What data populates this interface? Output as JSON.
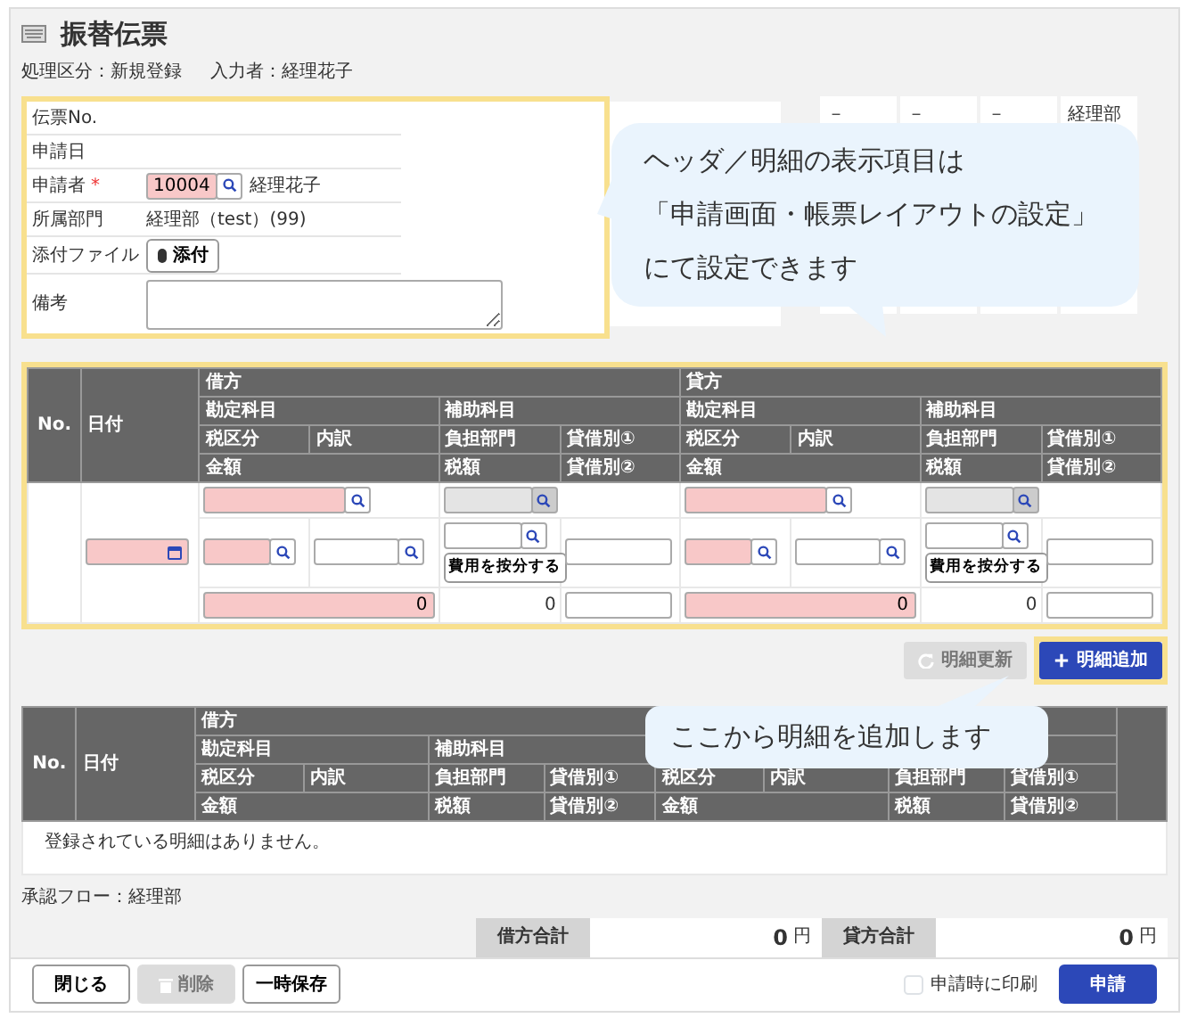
{
  "title": "振替伝票",
  "meta": [
    "処理区分：新規登録",
    "入力者：経理花子"
  ],
  "header_section": {
    "highlighted": true,
    "rows": [
      {
        "kind": "text",
        "label": "伝票No."
      },
      {
        "kind": "text",
        "label": "申請日"
      },
      {
        "kind": "lookup",
        "label": "申請者",
        "required_mark": "*",
        "value": "10004",
        "name_text": "経理花子"
      },
      {
        "kind": "text",
        "label": "所属部門",
        "value": "経理部（test）(99)"
      },
      {
        "kind": "attach",
        "label": "添付ファイル",
        "button": "添付"
      },
      {
        "kind": "textarea",
        "label": "備考"
      }
    ],
    "side_cells": [
      "－",
      "－",
      "－",
      "経理部"
    ],
    "callout": {
      "lines": [
        "ヘッダ／明細の表示項目は",
        "「申請画面・帳票レイアウトの設定」",
        "にて設定できます"
      ]
    }
  },
  "entry_table": {
    "highlighted": true,
    "header": {
      "no": "No.",
      "date": "日付",
      "sides": [
        {
          "title": "借方",
          "account": "勘定科目",
          "sub_account": "補助科目",
          "tax_class": "税区分",
          "detail": "内訳",
          "dept": "負担部門",
          "flag1": "貸借別①",
          "amount": "金額",
          "tax": "税額",
          "flag2": "貸借別②"
        },
        {
          "title": "貸方",
          "account": "勘定科目",
          "sub_account": "補助科目",
          "tax_class": "税区分",
          "detail": "内訳",
          "dept": "負担部門",
          "flag1": "貸借別①",
          "amount": "金額",
          "tax": "税額",
          "flag2": "貸借別②"
        }
      ]
    },
    "sides": [
      {
        "amount": "0",
        "tax": "0",
        "allocate_button": "費用を按分する"
      },
      {
        "amount": "0",
        "tax": "0",
        "allocate_button": "費用を按分する"
      }
    ]
  },
  "detail_buttons": {
    "buttons": [
      {
        "label": "明細更新",
        "kind": "update",
        "disabled": true,
        "highlighted": false
      },
      {
        "label": "明細追加",
        "kind": "add",
        "disabled": false,
        "highlighted": true
      }
    ],
    "callout": {
      "lines": [
        "ここから明細を追加します"
      ]
    }
  },
  "list_table": {
    "header": {
      "no": "No.",
      "date": "日付",
      "sides": [
        {
          "title": "借方",
          "account": "勘定科目",
          "sub_account": "補助科目",
          "tax_class": "税区分",
          "detail": "内訳",
          "dept": "負担部門",
          "flag1": "貸借別①",
          "amount": "金額",
          "tax": "税額",
          "flag2": "貸借別②"
        },
        {
          "tax_class": "税区分",
          "detail": "内訳",
          "dept": "負担部門",
          "flag1": "貸借別①",
          "amount": "金額",
          "tax": "税額",
          "flag2": "貸借別②"
        }
      ]
    },
    "empty_message": "登録されている明細はありません。"
  },
  "approval_flow": "承認フロー：経理部",
  "totals": [
    {
      "label": "借方合計",
      "amount": "0",
      "unit": "円"
    },
    {
      "label": "貸方合計",
      "amount": "0",
      "unit": "円"
    }
  ],
  "footer": {
    "buttons": [
      {
        "label": "閉じる",
        "disabled": false
      },
      {
        "label": "削除",
        "kind": "delete",
        "disabled": true
      },
      {
        "label": "一時保存",
        "disabled": false
      }
    ],
    "print_option": {
      "label": "申請時に印刷",
      "checked": false
    },
    "submit": "申請"
  }
}
